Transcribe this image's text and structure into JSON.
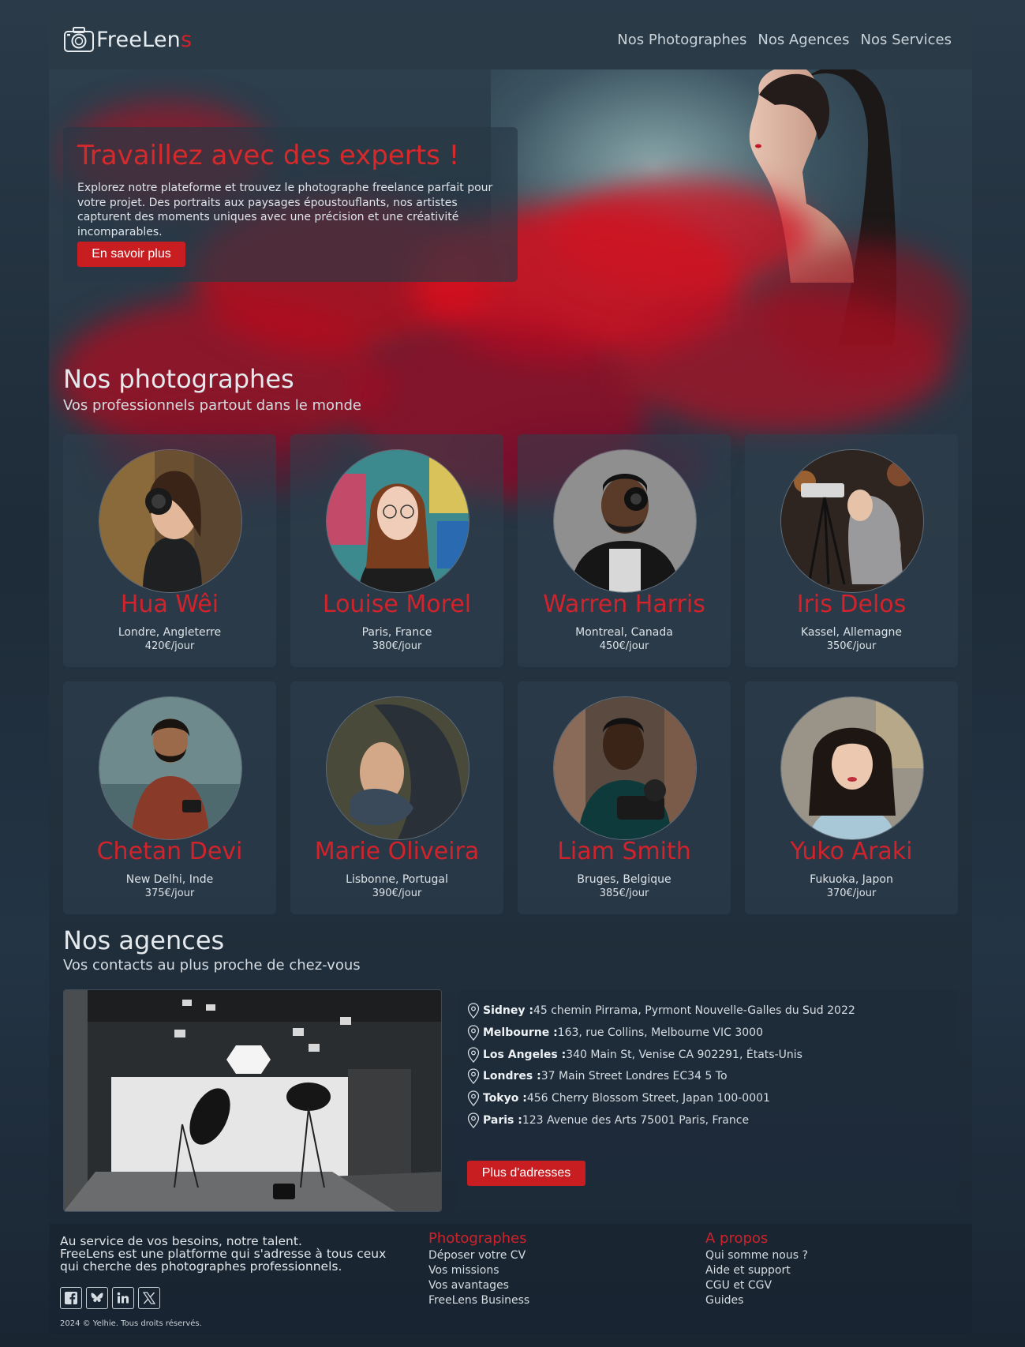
{
  "header": {
    "logo_main": "FreeLen",
    "logo_accent": "s",
    "nav": [
      "Nos Photographes",
      "Nos Agences",
      "Nos Services"
    ]
  },
  "hero": {
    "title": "Travaillez avec des experts !",
    "text": "Explorez notre plateforme et trouvez le photographe freelance parfait pour votre projet. Des portraits aux paysages époustouflants, nos artistes capturent des moments uniques avec une précision et une créativité incomparables.",
    "button": "En savoir plus"
  },
  "photographers_section": {
    "title": "Nos photographes",
    "subtitle": "Vos professionnels partout dans le monde"
  },
  "photographers": [
    {
      "name": "Hua Wêi",
      "city": "Londre, Angleterre",
      "price": "420€/jour"
    },
    {
      "name": "Louise Morel",
      "city": "Paris, France",
      "price": "380€/jour"
    },
    {
      "name": "Warren Harris",
      "city": "Montreal, Canada",
      "price": "450€/jour"
    },
    {
      "name": "Iris Delos",
      "city": "Kassel, Allemagne",
      "price": "350€/jour"
    },
    {
      "name": "Chetan Devi",
      "city": "New Delhi, Inde",
      "price": "375€/jour"
    },
    {
      "name": "Marie Oliveira",
      "city": "Lisbonne, Portugal",
      "price": "390€/jour"
    },
    {
      "name": "Liam Smith",
      "city": "Bruges, Belgique",
      "price": "385€/jour"
    },
    {
      "name": "Yuko Araki",
      "city": "Fukuoka, Japon",
      "price": "370€/jour"
    }
  ],
  "agencies_section": {
    "title": "Nos agences",
    "subtitle": "Vos contacts au plus proche de chez-vous"
  },
  "agencies": [
    {
      "city": "Sidney :",
      "address": " 45 chemin Pirrama, Pyrmont Nouvelle-Galles du Sud 2022"
    },
    {
      "city": "Melbourne :",
      "address": " 163, rue Collins, Melbourne VIC 3000"
    },
    {
      "city": "Los Angeles :",
      "address": " 340 Main St, Venise CA 902291, États-Unis"
    },
    {
      "city": "Londres :",
      "address": " 37 Main Street Londres EC34 5 To"
    },
    {
      "city": "Tokyo :",
      "address": " 456 Cherry Blossom Street, Japan 100-0001"
    },
    {
      "city": "Paris :",
      "address": " 123 Avenue des Arts 75001 Paris, France"
    }
  ],
  "agencies_button": "Plus d'adresses",
  "footer": {
    "tagline": "Au service de vos besoins, notre talent.",
    "desc1": "FreeLens est une platforme qui s'adresse à tous ceux",
    "desc2": "qui cherche des photographes professionnels.",
    "copyright": "2024 © Yelhie. Tous droits réservés.",
    "col1": {
      "title": "Photographes",
      "links": [
        "Déposer votre CV",
        "Vos missions",
        "Vos avantages",
        "FreeLens Business"
      ]
    },
    "col2": {
      "title": "A propos",
      "links": [
        "Qui somme nous ?",
        "Aide et support",
        "CGU et CGV",
        "Guides"
      ]
    },
    "socials": [
      "facebook-icon",
      "bluesky-icon",
      "linkedin-icon",
      "x-icon"
    ]
  },
  "colors": {
    "accent": "#d0222a",
    "background": "#24323f"
  }
}
